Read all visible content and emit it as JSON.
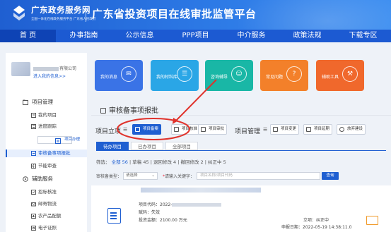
{
  "header": {
    "brand_title": "广东政务服务网",
    "brand_subtitle": "全国一体化在线政务服务平台 广东省人民政府",
    "page_title": "广东省投资项目在线审批监管平台"
  },
  "nav": [
    {
      "label": "首 页",
      "active": true
    },
    {
      "label": "办事指南",
      "active": false
    },
    {
      "label": "公示信息",
      "active": false
    },
    {
      "label": "PPP项目",
      "active": false
    },
    {
      "label": "中介服务",
      "active": false
    },
    {
      "label": "政策法规",
      "active": false
    },
    {
      "label": "下载专区",
      "active": false
    }
  ],
  "user": {
    "name_suffix": "有限公司",
    "link": "进入我的信息>>"
  },
  "sidebar": {
    "groups": [
      {
        "label": "项目管理",
        "icon": "folder-icon",
        "items": [
          {
            "label": "我的项目",
            "icon": "project-icon",
            "active": false
          },
          {
            "label": "进度跟踪",
            "icon": "progress-icon",
            "active": false
          }
        ]
      },
      {
        "label": "项目办理",
        "icon": "handle-icon",
        "selected": true,
        "items": [
          {
            "label": "审核备事项报批",
            "icon": "approval-icon",
            "active": true
          },
          {
            "label": "节能审查",
            "icon": "energy-icon",
            "active": false
          }
        ]
      },
      {
        "label": "辅助服务",
        "icon": "service-icon",
        "items": [
          {
            "label": "招标核准",
            "icon": "bid-icon",
            "active": false
          },
          {
            "label": "邮寄物流",
            "icon": "mail-icon",
            "active": false
          },
          {
            "label": "农产品配额",
            "icon": "quota-icon",
            "active": false
          },
          {
            "label": "电子证照",
            "icon": "license-icon",
            "active": false
          }
        ]
      }
    ]
  },
  "cards": [
    {
      "label": "我的消息",
      "color": "#3a73e6",
      "icon": "message-icon",
      "glyph": "✉"
    },
    {
      "label": "我的材料库",
      "color": "#2aa6e6",
      "icon": "materials-icon",
      "glyph": "☰"
    },
    {
      "label": "咨询辅导",
      "color": "#19b7a6",
      "icon": "consult-icon",
      "glyph": "☺"
    },
    {
      "label": "常见问题",
      "color": "#f3802a",
      "icon": "faq-icon",
      "glyph": "?"
    },
    {
      "label": "辅助工具",
      "color": "#f0682c",
      "icon": "tools-icon",
      "glyph": "⚒"
    }
  ],
  "section_title": "审核备事项报批",
  "project_approval": {
    "label": "项目立项",
    "buttons": [
      {
        "label": "项目备案",
        "active": true
      },
      {
        "label": "项目核准",
        "active": false
      },
      {
        "label": "项目审批",
        "active": false
      }
    ]
  },
  "project_management": {
    "label": "项目管理",
    "buttons": [
      {
        "label": "项目变更",
        "active": false
      },
      {
        "label": "项目延期",
        "active": false
      },
      {
        "label": "放弃建设",
        "active": false
      }
    ]
  },
  "tabs": [
    {
      "label": "待办项目",
      "active": true
    },
    {
      "label": "已办项目",
      "active": false
    },
    {
      "label": "全部项目",
      "active": false
    }
  ],
  "filter": {
    "prefix": "筛选：",
    "all_label": "全部",
    "all_count": "56",
    "items": [
      {
        "label": "草稿",
        "count": "45"
      },
      {
        "label": "退回修改",
        "count": "4"
      },
      {
        "label": "撤回修改",
        "count": "2"
      },
      {
        "label": "纠正中",
        "count": "5"
      }
    ]
  },
  "search": {
    "type_label": "审核备类型：",
    "type_value": "请选择",
    "keyword_label": "请输入关键字：",
    "keyword_placeholder": "项目名称/项目代码",
    "button": "查询"
  },
  "result": {
    "code_label": "项目代码：2022-",
    "sub_label": "赋码：失效",
    "invest_label": "投资金额：2100.00 万元",
    "status": "立项：纠正中",
    "time": "申报日期：2022-05-19 14:38:11.0"
  },
  "annotation_color": "#e0322b"
}
